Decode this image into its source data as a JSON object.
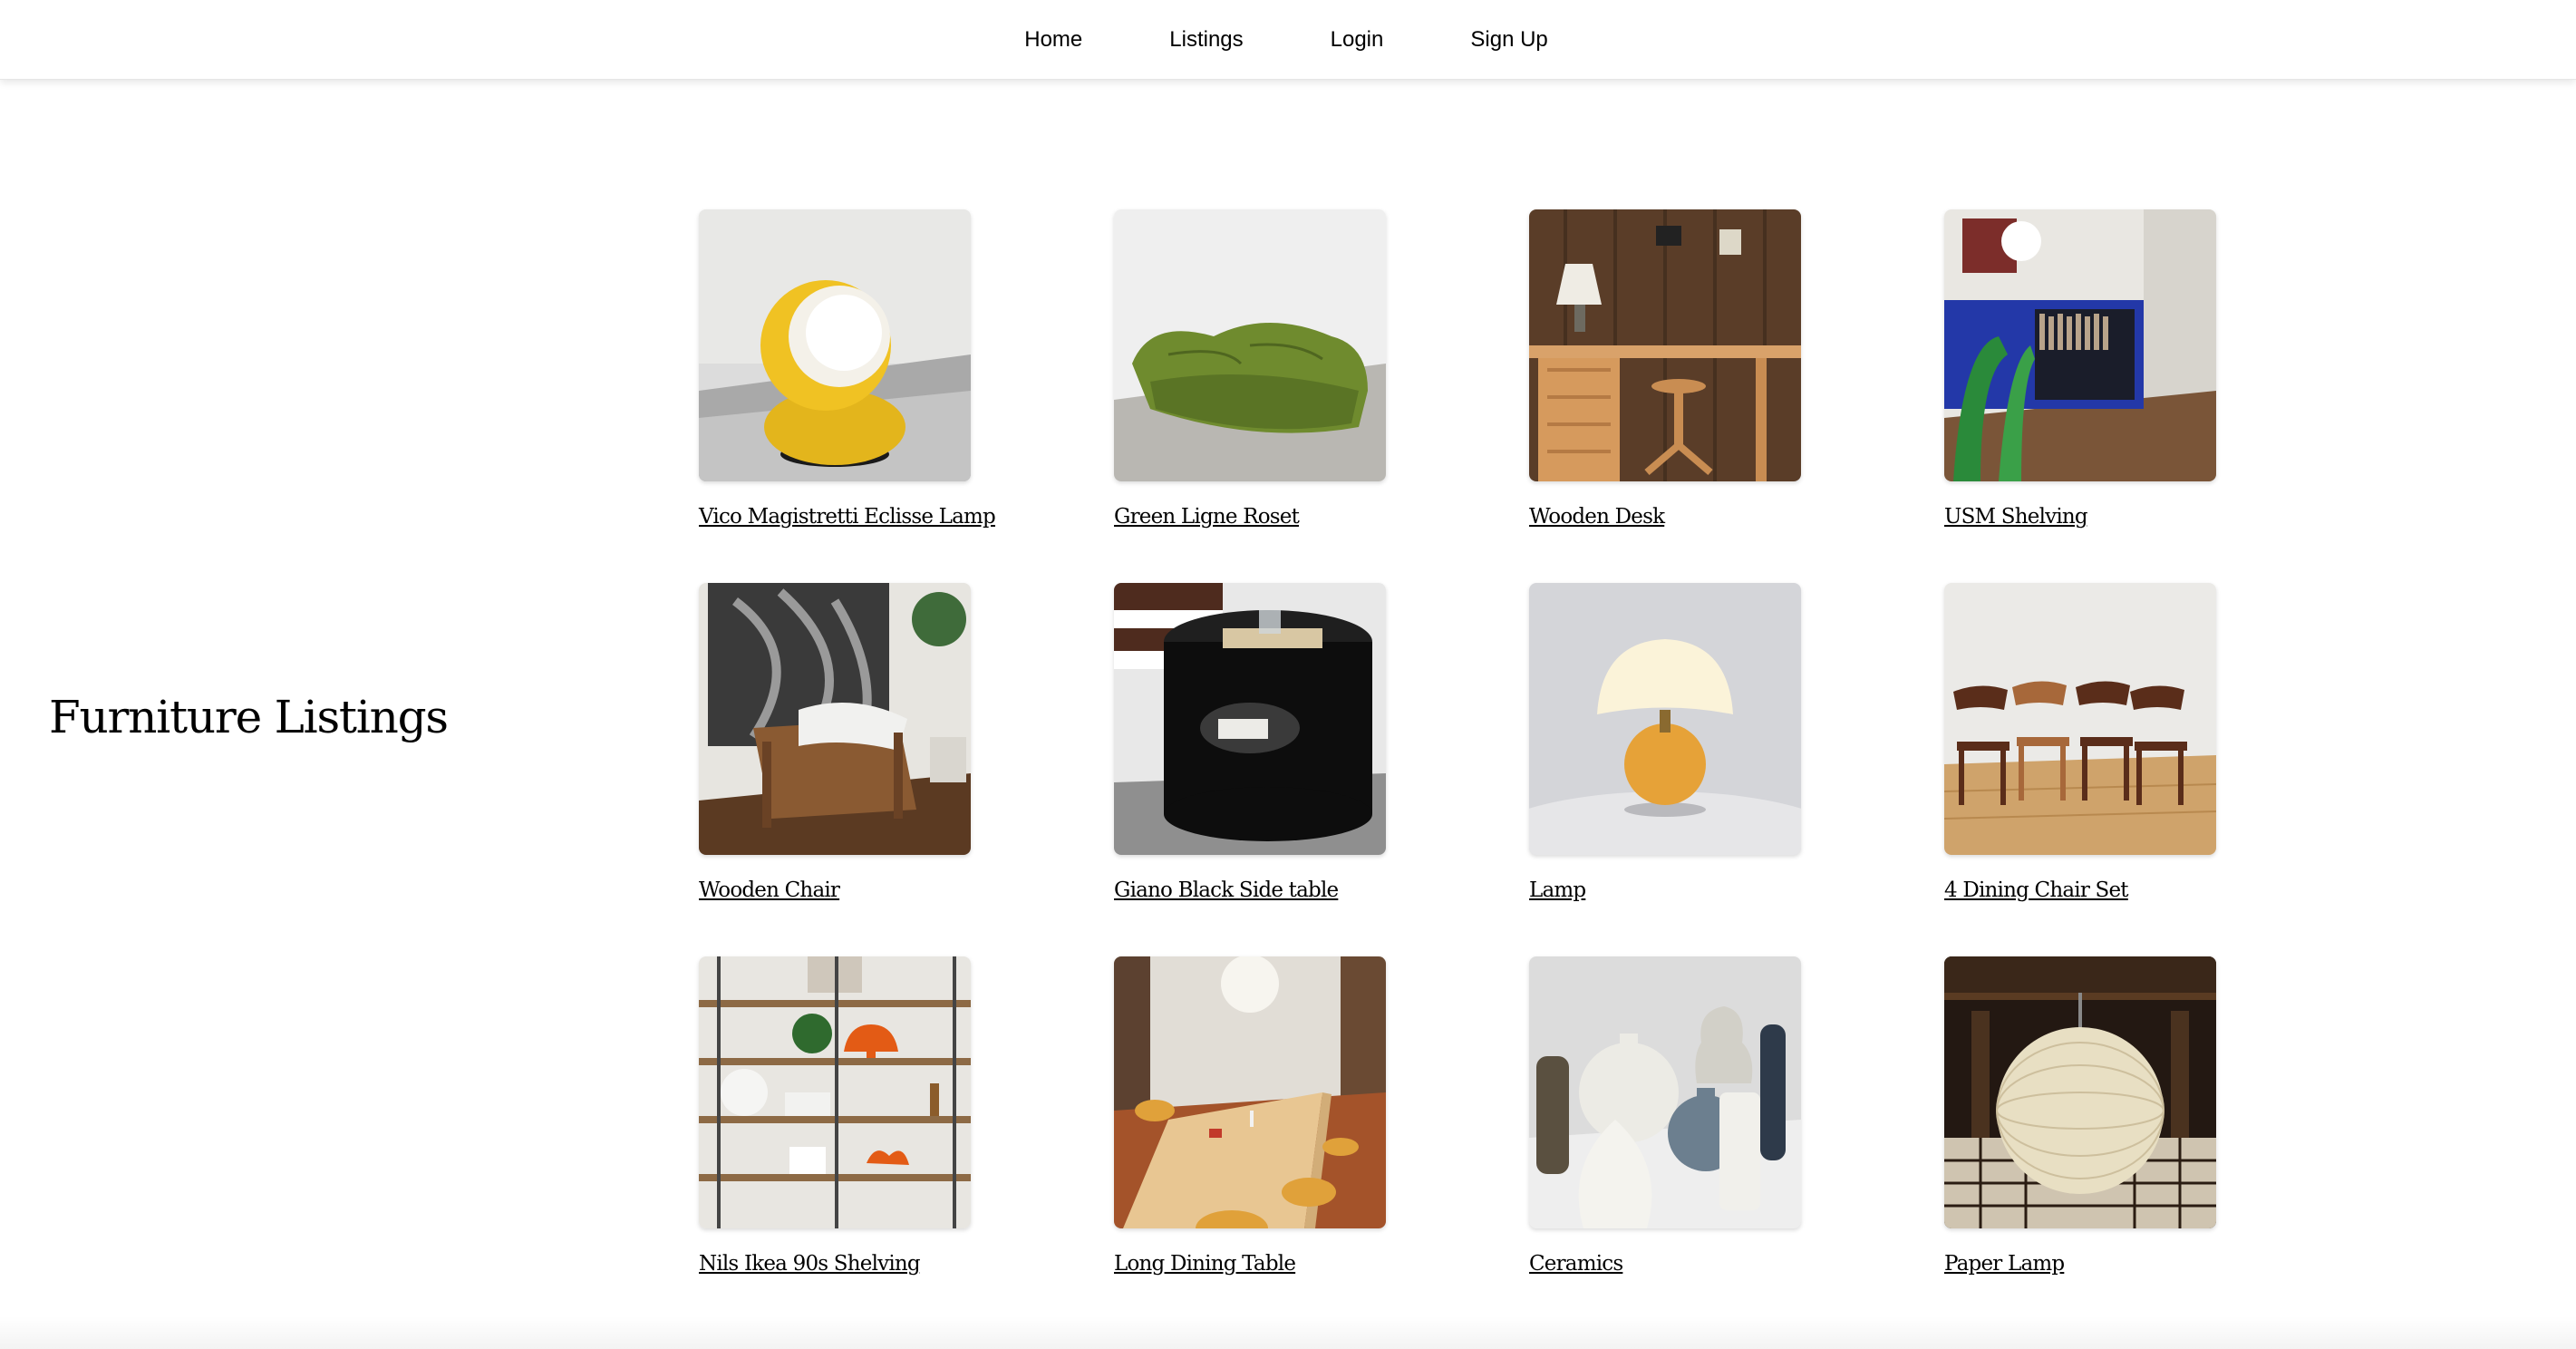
{
  "nav": {
    "items": [
      {
        "label": "Home"
      },
      {
        "label": "Listings"
      },
      {
        "label": "Login"
      },
      {
        "label": "Sign Up"
      }
    ]
  },
  "page": {
    "title": "Furniture Listings"
  },
  "listings": [
    {
      "title": "Vico Magistretti Eclisse Lamp"
    },
    {
      "title": "Green Ligne Roset"
    },
    {
      "title": "Wooden Desk"
    },
    {
      "title": "USM Shelving"
    },
    {
      "title": "Wooden Chair"
    },
    {
      "title": "Giano Black Side table"
    },
    {
      "title": "Lamp"
    },
    {
      "title": "4 Dining Chair Set"
    },
    {
      "title": "Nils Ikea 90s Shelving"
    },
    {
      "title": "Long Dining Table"
    },
    {
      "title": "Ceramics"
    },
    {
      "title": "Paper Lamp"
    }
  ]
}
